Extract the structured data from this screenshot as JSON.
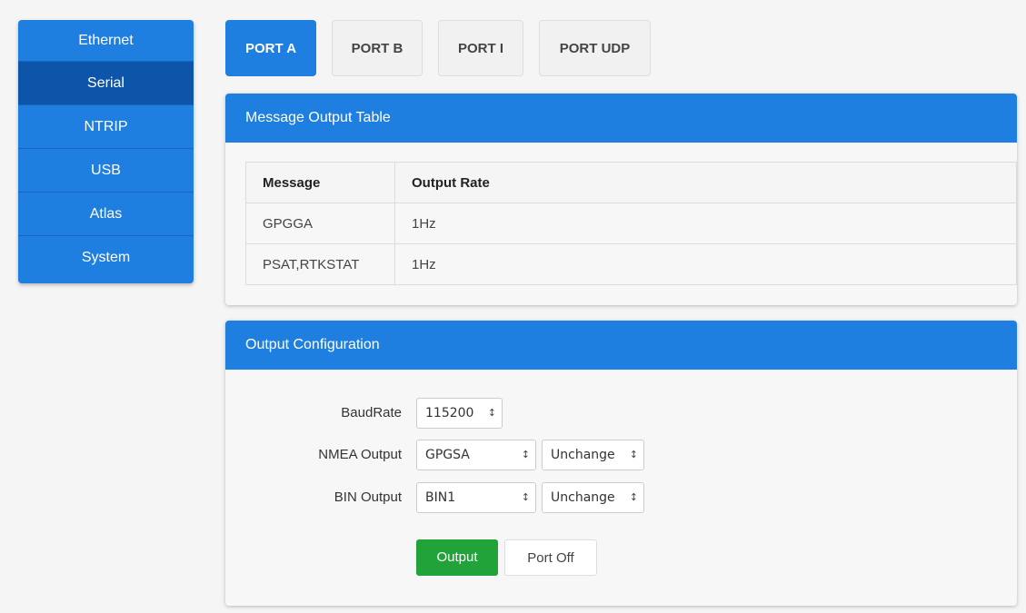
{
  "sidebar": {
    "items": [
      {
        "label": "Ethernet"
      },
      {
        "label": "Serial"
      },
      {
        "label": "NTRIP"
      },
      {
        "label": "USB"
      },
      {
        "label": "Atlas"
      },
      {
        "label": "System"
      }
    ],
    "active": "Serial"
  },
  "tabs": [
    {
      "label": "PORT A"
    },
    {
      "label": "PORT B"
    },
    {
      "label": "PORT I"
    },
    {
      "label": "PORT UDP"
    }
  ],
  "message_table": {
    "title": "Message Output Table",
    "headers": [
      "Message",
      "Output Rate"
    ],
    "rows": [
      [
        "GPGGA",
        "1Hz"
      ],
      [
        "PSAT,RTKSTAT",
        "1Hz"
      ]
    ]
  },
  "output_config": {
    "title": "Output Configuration",
    "baudrate_label": "BaudRate",
    "baudrate_value": "115200",
    "nmea_label": "NMEA Output",
    "nmea_value": "GPGSA",
    "nmea_rate": "Unchange",
    "bin_label": "BIN Output",
    "bin_value": "BIN1",
    "bin_rate": "Unchange",
    "output_button": "Output",
    "port_off_button": "Port Off"
  },
  "colors": {
    "accent": "#1f7fe0",
    "active_nav": "#0d55a8",
    "output_button": "#21a33a"
  }
}
